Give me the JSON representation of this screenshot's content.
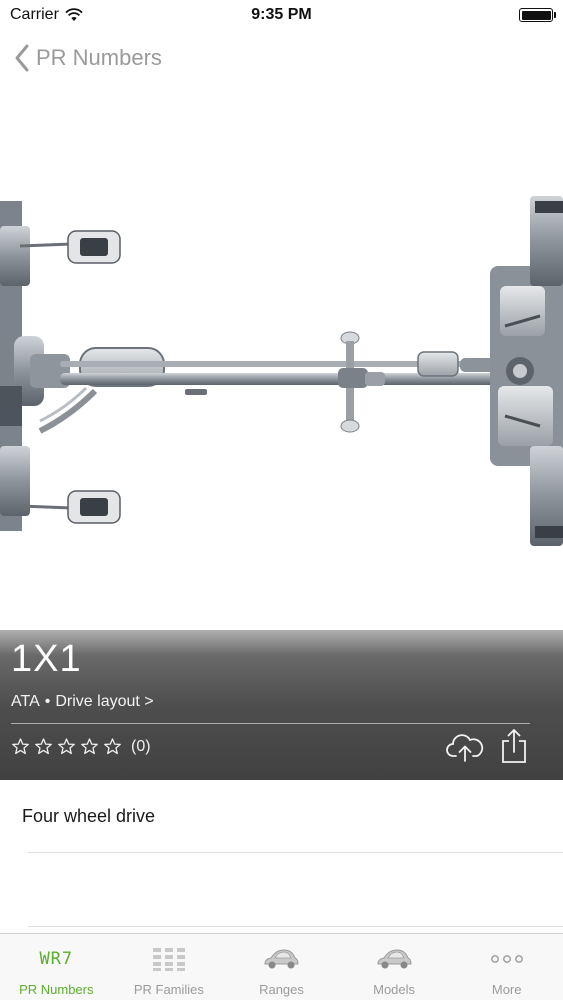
{
  "status_bar": {
    "carrier": "Carrier",
    "time": "9:35 PM",
    "battery_level": 1.0
  },
  "nav": {
    "back_label": "PR Numbers"
  },
  "item": {
    "code": "1X1",
    "family_code": "ATA",
    "separator": "•",
    "family_name": "Drive layout >",
    "rating_count": "(0)",
    "stars_total": 5,
    "stars_filled": 0,
    "description": "Four wheel drive"
  },
  "icons": {
    "upload": "cloud-upload-icon",
    "share": "share-icon",
    "back": "chevron-left-icon"
  },
  "tabs": [
    {
      "label": "PR Numbers",
      "icon_text": "WR7",
      "icon": "wr7-icon",
      "active": true
    },
    {
      "label": "PR Families",
      "icon": "grid-icon",
      "active": false
    },
    {
      "label": "Ranges",
      "icon": "beetle-car-icon",
      "active": false
    },
    {
      "label": "Models",
      "icon": "beetle-car-icon",
      "active": false
    },
    {
      "label": "More",
      "icon": "more-dots-icon",
      "active": false
    }
  ],
  "colors": {
    "accent_green": "#5cae2e",
    "inactive_gray": "#9b9b9b",
    "panel_dark": "#414141"
  }
}
